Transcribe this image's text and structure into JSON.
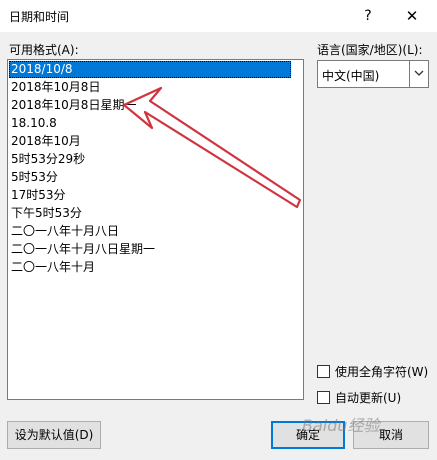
{
  "window": {
    "title": "日期和时间",
    "help_label": "?",
    "close_label": "✕"
  },
  "formats": {
    "label": "可用格式(A):",
    "items": [
      "2018/10/8",
      "2018年10月8日",
      "2018年10月8日星期一",
      "18.10.8",
      "2018年10月",
      "5时53分29秒",
      "5时53分",
      "17时53分",
      "下午5时53分",
      "二〇一八年十月八日",
      "二〇一八年十月八日星期一",
      "二〇一八年十月"
    ],
    "selected_index": 0
  },
  "language": {
    "label": "语言(国家/地区)(L):",
    "selected": "中文(中国)"
  },
  "options": {
    "fullwidth_label": "使用全角字符(W)",
    "autoupdate_label": "自动更新(U)"
  },
  "buttons": {
    "set_default": "设为默认值(D)",
    "ok": "确定",
    "cancel": "取消"
  },
  "annotation": {
    "arrow_color": "#d0353f"
  },
  "watermark": "Baidu经验"
}
